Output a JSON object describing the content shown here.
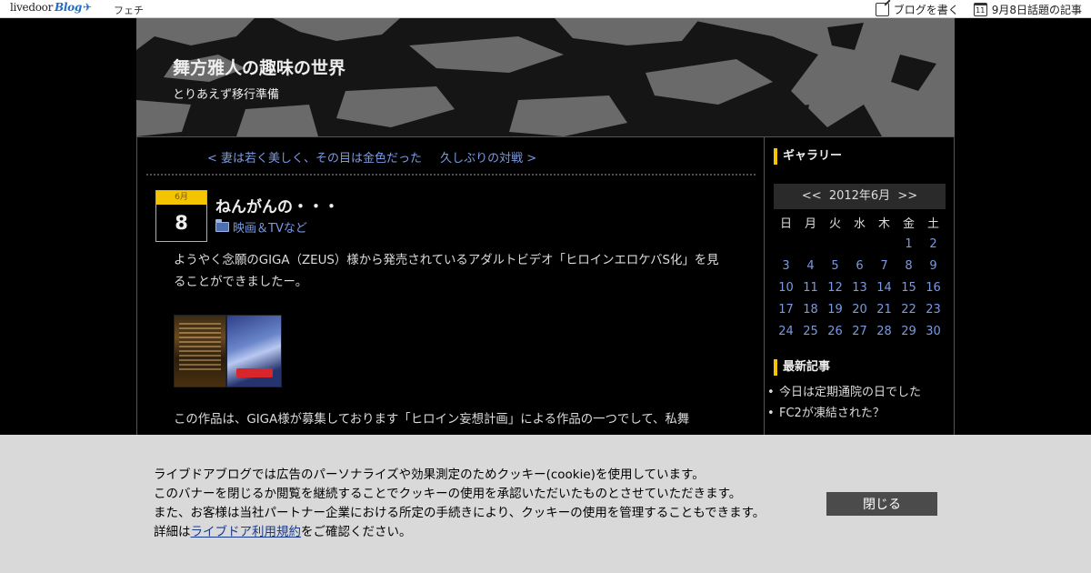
{
  "topbar": {
    "logo_text": "livedoor",
    "logo_blog": "Blog",
    "category": "フェチ",
    "write_link": "ブログを書く",
    "topic_link": "9月8日話題の記事",
    "calendar_icon_num": "11"
  },
  "header": {
    "title": "舞方雅人の趣味の世界",
    "description": "とりあえず移行準備"
  },
  "pager": {
    "prev": "< 妻は若く美しく、その目は金色だった",
    "next": "久しぶりの対戦 >"
  },
  "entry": {
    "month": "6月",
    "day": "8",
    "title": "ねんがんの・・・",
    "category": "映画＆TVなど",
    "paragraph1": "ようやく念願のGIGA（ZEUS）様から発売されているアダルトビデオ「ヒロインエロケバS化」を見ることができましたー。",
    "paragraph2": "この作品は、GIGA様が募集しております「ヒロイン妄想計画」による作品の一つでして、私舞"
  },
  "sidebar": {
    "gallery_heading": "ギャラリー",
    "calendar": {
      "nav_prev": "<<",
      "month_label": "2012年6月",
      "nav_next": ">>",
      "weekdays": [
        "日",
        "月",
        "火",
        "水",
        "木",
        "金",
        "土"
      ],
      "weeks": [
        [
          "",
          "",
          "",
          "",
          "",
          "1",
          "2"
        ],
        [
          "3",
          "4",
          "5",
          "6",
          "7",
          "8",
          "9"
        ],
        [
          "10",
          "11",
          "12",
          "13",
          "14",
          "15",
          "16"
        ],
        [
          "17",
          "18",
          "19",
          "20",
          "21",
          "22",
          "23"
        ],
        [
          "24",
          "25",
          "26",
          "27",
          "28",
          "29",
          "30"
        ]
      ]
    },
    "recent_heading": "最新記事",
    "recent_items": [
      "今日は定期通院の日でした",
      "FC2が凍結された？"
    ]
  },
  "cookie": {
    "line1": "ライブドアブログでは広告のパーソナライズや効果測定のためクッキー(cookie)を使用しています。",
    "line2": "このバナーを閉じるか閲覧を継続することでクッキーの使用を承認いただいたものとさせていただきます。",
    "line3": "また、お客様は当社パートナー企業における所定の手続きにより、クッキーの使用を管理することもできます。",
    "line4_prefix": "詳細は",
    "line4_link": "ライブドア利用規約",
    "line4_suffix": "をご確認ください。",
    "close_label": "閉じる"
  },
  "colors": {
    "accent_yellow": "#f5c400",
    "link_blue": "#7a9ae0",
    "banner_bg": "#d9d9d9",
    "close_button": "#4b4b4b"
  }
}
